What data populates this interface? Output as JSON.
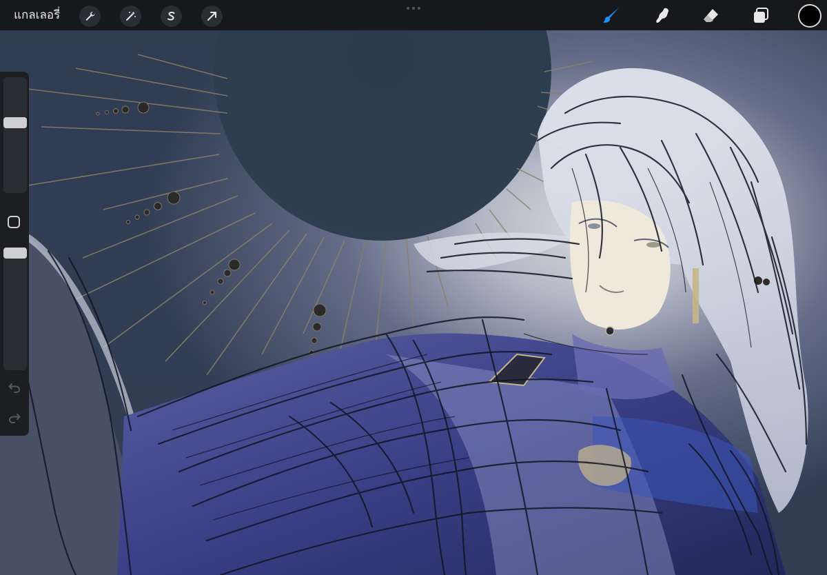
{
  "app": {
    "gallery_label": "แกลเลอรี่"
  },
  "toolbar": {
    "left_tools": [
      "wrench-icon",
      "magic-wand-icon",
      "selection-s-icon",
      "transform-arrow-icon"
    ],
    "right_tools": [
      "brush-icon",
      "smudge-icon",
      "eraser-icon",
      "layers-icon"
    ],
    "active_tool": "brush-icon",
    "active_color": "#000000",
    "accent_color": "#1f8ff0"
  },
  "sidebar": {
    "brush_size_level": 0.38,
    "opacity_level": 0.0,
    "undo_icon": "undo-icon",
    "redo_icon": "redo-icon"
  },
  "canvas": {
    "background_color": "#2c3b4d",
    "artwork": "sketch-artwork"
  }
}
